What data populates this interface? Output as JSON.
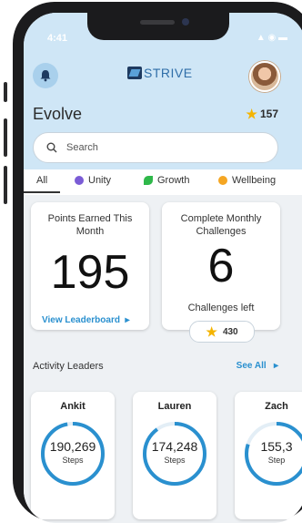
{
  "status": {
    "time": "4:41",
    "icons": "▲ ◉ ▬"
  },
  "brand": {
    "name": "STRIVE"
  },
  "page": {
    "title": "Evolve",
    "points": "157"
  },
  "search": {
    "placeholder": "Search"
  },
  "tabs": [
    {
      "label": "All",
      "icon": "",
      "color": ""
    },
    {
      "label": "Unity",
      "icon": "globe-icon",
      "color": "#7b5cd6"
    },
    {
      "label": "Growth",
      "icon": "leaf-icon",
      "color": "#2fb84a"
    },
    {
      "label": "Wellbeing",
      "icon": "drop-icon",
      "color": "#f5a623"
    }
  ],
  "points_card": {
    "title": "Points Earned This Month",
    "value": "195",
    "link": "View Leaderboard"
  },
  "challenges_card": {
    "title": "Complete Monthly Challenges",
    "value": "6",
    "caption": "Challenges left",
    "points": "430"
  },
  "leaders": {
    "label": "Activity Leaders",
    "see_all": "See All",
    "items": [
      {
        "name": "Ankit",
        "steps": "190,269",
        "unit": "Steps",
        "progress": 0.97
      },
      {
        "name": "Lauren",
        "steps": "174,248",
        "unit": "Steps",
        "progress": 0.9
      },
      {
        "name": "Zach",
        "steps": "155,3",
        "unit": "Step",
        "progress": 0.8
      }
    ]
  },
  "colors": {
    "accent": "#2a90cf",
    "header_bg": "#cfe6f6",
    "star": "#f4b400"
  }
}
